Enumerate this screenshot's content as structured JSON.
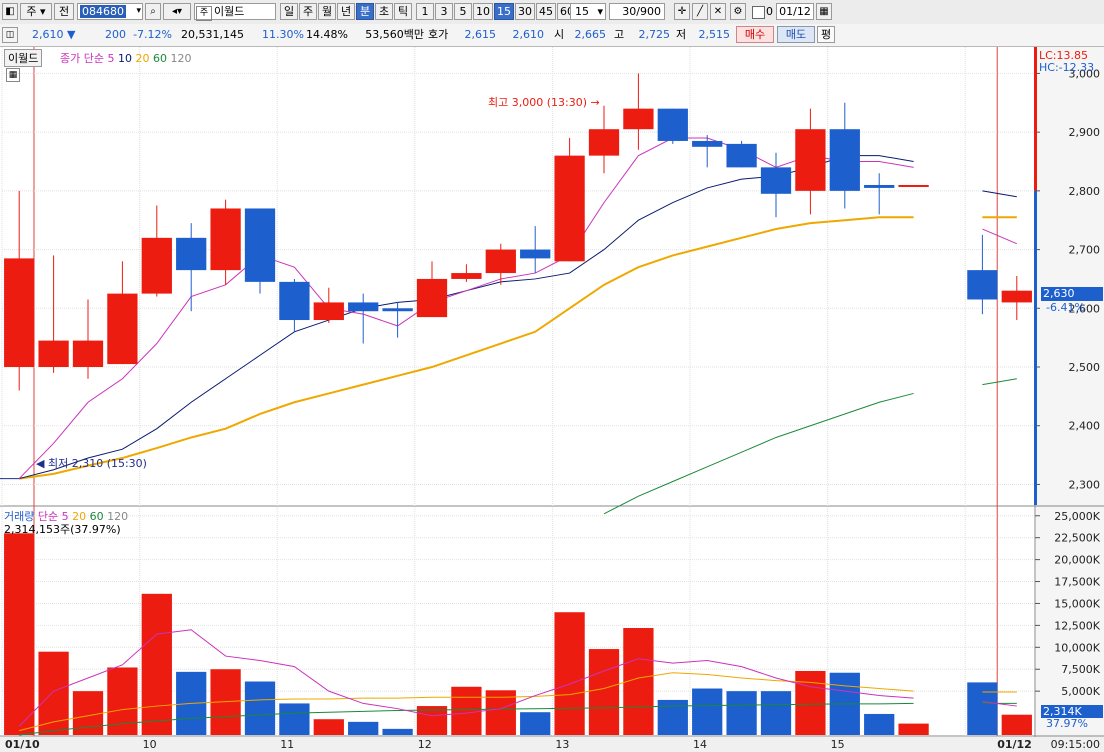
{
  "toolbar": {
    "period_prefix": "주",
    "prev_label": "전",
    "code": "084680",
    "name": "이월드",
    "period_buttons": [
      "일",
      "주",
      "월",
      "년",
      "분",
      "초",
      "틱"
    ],
    "interval_buttons": [
      "1",
      "3",
      "5",
      "10",
      "15",
      "30",
      "45",
      "60"
    ],
    "interval_input": "15",
    "count": "30/900",
    "checkbox_value": "0",
    "date": "01/12"
  },
  "quote": {
    "price": "2,610",
    "change": "200",
    "change_pct": "-7.12%",
    "volume": "20,531,145",
    "turnover_pct": "11.30%",
    "pct2": "14.48%",
    "amount": "53,560백만",
    "bid_label": "호가",
    "ask": "2,615",
    "bid": "2,610",
    "open_label": "시",
    "open": "2,665",
    "high_label": "고",
    "high": "2,725",
    "low_label": "저",
    "low": "2,515",
    "buy_button": "매수",
    "sell_button": "매도",
    "last_button": "평"
  },
  "colors": {
    "up": "#ec1c10",
    "down": "#1e5fce",
    "ma5": "#cc33bb",
    "ma10": "#0a1a6e",
    "ma20": "#eea800",
    "ma60": "#1a8a3a",
    "ma120": "#888888"
  },
  "price_panel": {
    "stock_tag": "이월드",
    "legend": [
      "종가 단순 5",
      "10",
      "20",
      "60",
      "120"
    ],
    "lc": "LC:13.85",
    "hc": "HC:-12.33",
    "current_price_label": "2,630",
    "current_pct_label": "-6.41%",
    "max_note": "최고 3,000 (13:30)",
    "min_note": "최저 2,310 (15:30)"
  },
  "volume_panel": {
    "legend": [
      "거래량",
      "단순 5",
      "20",
      "60",
      "120"
    ],
    "current_label": "2,314,153주(37.97%)",
    "current_badge": "2,314K",
    "current_pct": "37.97%"
  },
  "x_axis": {
    "labels": [
      "01/10",
      "10",
      "11",
      "12",
      "13",
      "14",
      "15",
      "01/12"
    ],
    "time": "09:15:00"
  },
  "chart_data": {
    "type": "candlestick",
    "price_axis": {
      "ticks": [
        "2,300",
        "2,400",
        "2,500",
        "2,600",
        "2,700",
        "2,800",
        "2,900",
        "3,000"
      ],
      "ylim": [
        2265,
        3045
      ]
    },
    "volume_axis": {
      "ticks": [
        "5,000K",
        "7,500K",
        "10,000K",
        "12,500K",
        "15,000K",
        "17,500K",
        "20,000K",
        "22,500K",
        "25,000K"
      ],
      "ylim": [
        0,
        26000
      ]
    },
    "candles": [
      {
        "o": 2500,
        "h": 2800,
        "l": 2460,
        "c": 2685
      },
      {
        "o": 2500,
        "h": 2690,
        "l": 2490,
        "c": 2545
      },
      {
        "o": 2500,
        "h": 2615,
        "l": 2480,
        "c": 2545
      },
      {
        "o": 2505,
        "h": 2680,
        "l": 2505,
        "c": 2625
      },
      {
        "o": 2625,
        "h": 2775,
        "l": 2620,
        "c": 2720
      },
      {
        "o": 2720,
        "h": 2745,
        "l": 2595,
        "c": 2665
      },
      {
        "o": 2665,
        "h": 2785,
        "l": 2640,
        "c": 2770
      },
      {
        "o": 2770,
        "h": 2770,
        "l": 2625,
        "c": 2645
      },
      {
        "o": 2645,
        "h": 2650,
        "l": 2560,
        "c": 2580
      },
      {
        "o": 2580,
        "h": 2635,
        "l": 2575,
        "c": 2610
      },
      {
        "o": 2610,
        "h": 2625,
        "l": 2540,
        "c": 2595
      },
      {
        "o": 2600,
        "h": 2610,
        "l": 2550,
        "c": 2595
      },
      {
        "o": 2585,
        "h": 2680,
        "l": 2585,
        "c": 2650
      },
      {
        "o": 2650,
        "h": 2675,
        "l": 2645,
        "c": 2660
      },
      {
        "o": 2660,
        "h": 2710,
        "l": 2640,
        "c": 2700
      },
      {
        "o": 2700,
        "h": 2740,
        "l": 2660,
        "c": 2685
      },
      {
        "o": 2680,
        "h": 2890,
        "l": 2680,
        "c": 2860
      },
      {
        "o": 2860,
        "h": 2945,
        "l": 2830,
        "c": 2905
      },
      {
        "o": 2905,
        "h": 3000,
        "l": 2870,
        "c": 2940
      },
      {
        "o": 2940,
        "h": 2940,
        "l": 2880,
        "c": 2885
      },
      {
        "o": 2885,
        "h": 2895,
        "l": 2840,
        "c": 2875
      },
      {
        "o": 2880,
        "h": 2885,
        "l": 2840,
        "c": 2840
      },
      {
        "o": 2840,
        "h": 2865,
        "l": 2755,
        "c": 2795
      },
      {
        "o": 2800,
        "h": 2940,
        "l": 2760,
        "c": 2905
      },
      {
        "o": 2905,
        "h": 2950,
        "l": 2770,
        "c": 2800
      },
      {
        "o": 2810,
        "h": 2830,
        "l": 2760,
        "c": 2805
      },
      {
        "o": 2810,
        "h": 2810,
        "l": 2810,
        "c": 2810
      },
      null,
      {
        "o": 2665,
        "h": 2725,
        "l": 2590,
        "c": 2615
      },
      {
        "o": 2610,
        "h": 2655,
        "l": 2580,
        "c": 2630
      }
    ],
    "volume": [
      23000,
      9500,
      5000,
      7700,
      16100,
      7200,
      7500,
      6100,
      3600,
      1800,
      1500,
      700,
      3300,
      5500,
      5100,
      2600,
      14000,
      9800,
      12200,
      4000,
      5300,
      5000,
      5000,
      7300,
      7100,
      2400,
      1300,
      null,
      6000,
      2314
    ],
    "ma5": [
      2310,
      2370,
      2440,
      2480,
      2540,
      2620,
      2640,
      2690,
      2670,
      2600,
      2590,
      2570,
      2610,
      2630,
      2650,
      2660,
      2690,
      2780,
      2860,
      2890,
      2890,
      2870,
      2840,
      2860,
      2850,
      2850,
      2840,
      null,
      2735,
      2710
    ],
    "ma10": [
      2310,
      2325,
      2345,
      2360,
      2395,
      2440,
      2480,
      2520,
      2560,
      2580,
      2600,
      2610,
      2615,
      2630,
      2645,
      2650,
      2660,
      2700,
      2750,
      2780,
      2805,
      2820,
      2825,
      2840,
      2860,
      2860,
      2850,
      null,
      2800,
      2790
    ],
    "ma20": [
      2310,
      2318,
      2332,
      2345,
      2362,
      2380,
      2395,
      2420,
      2440,
      2455,
      2470,
      2485,
      2500,
      2520,
      2540,
      2560,
      2600,
      2640,
      2670,
      2690,
      2705,
      2720,
      2735,
      2745,
      2750,
      2755,
      2755,
      null,
      2755,
      2755
    ],
    "ma60": [
      null,
      null,
      null,
      null,
      null,
      null,
      null,
      null,
      null,
      null,
      null,
      null,
      null,
      null,
      null,
      null,
      null,
      2250,
      2280,
      2305,
      2330,
      2355,
      2380,
      2400,
      2420,
      2440,
      2455,
      null,
      2470,
      2480
    ],
    "vol_ma5": [
      1000,
      5000,
      6500,
      8000,
      11500,
      12000,
      9000,
      8500,
      7800,
      5000,
      3600,
      3000,
      2200,
      2500,
      3000,
      4500,
      5800,
      7300,
      8700,
      8200,
      8500,
      7800,
      6500,
      5500,
      5000,
      4500,
      4200,
      null,
      3800,
      3300
    ],
    "vol_ma20": [
      500,
      1500,
      2200,
      2900,
      3300,
      3600,
      3800,
      4000,
      4100,
      4100,
      4200,
      4200,
      4300,
      4300,
      4300,
      4400,
      4600,
      5300,
      6500,
      7100,
      6900,
      6500,
      6200,
      6000,
      5600,
      5300,
      5000,
      null,
      4900,
      4900
    ],
    "vol_ma60": [
      0,
      500,
      900,
      1300,
      1600,
      1900,
      2100,
      2300,
      2500,
      2600,
      2700,
      2800,
      2850,
      2900,
      2950,
      3000,
      3050,
      3100,
      3200,
      3300,
      3350,
      3400,
      3450,
      3500,
      3550,
      3550,
      3600,
      null,
      3600,
      3600
    ]
  }
}
